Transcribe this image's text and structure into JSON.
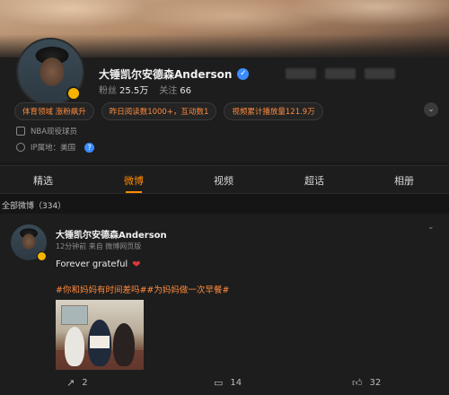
{
  "profile": {
    "name": "大锤凯尔安德森Anderson",
    "fans_label": "粉丝",
    "fans_count": "25.5万",
    "following_label": "关注",
    "following_count": "66",
    "tags": [
      "体育领域 涨粉飙升",
      "昨日阅读数1000+，互动数1",
      "视频累计播放量121.9万"
    ],
    "description": "NBA现役球员",
    "ip_location": "IP属地：美国"
  },
  "tabs": [
    {
      "label": "精选"
    },
    {
      "label": "微博",
      "active": true
    },
    {
      "label": "视频"
    },
    {
      "label": "超话"
    },
    {
      "label": "相册"
    }
  ],
  "feed": {
    "count_label": "全部微博（334）"
  },
  "post": {
    "author": "大锤凯尔安德森Anderson",
    "meta": "12分钟前 来自 微博网页版",
    "text": "Forever grateful",
    "hashtags": "#你和妈妈有时间差吗##为妈妈做一次早餐#",
    "reposts": "2",
    "comments": "14",
    "likes": "32"
  },
  "colors": {
    "accent": "#ff8a00",
    "tag_text": "#ff8a3d",
    "verified": "#3c8cff",
    "heart": "#e0383a",
    "background": "#1d1d1d"
  }
}
